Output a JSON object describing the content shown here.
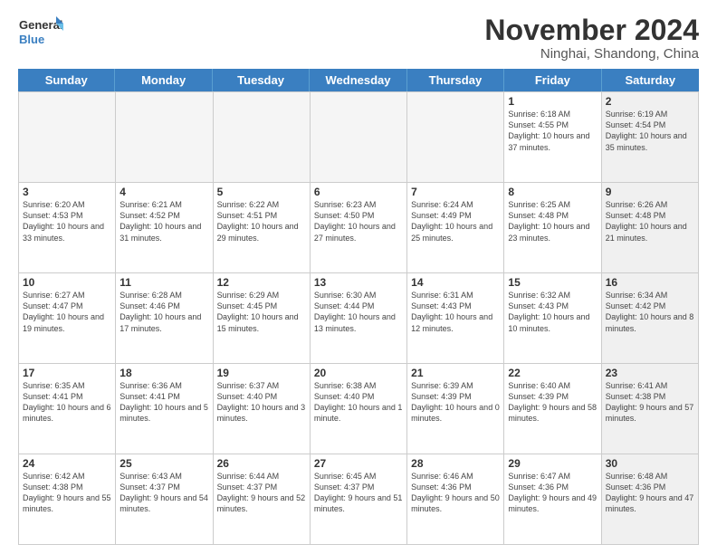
{
  "header": {
    "logo_line1": "General",
    "logo_line2": "Blue",
    "month_title": "November 2024",
    "location": "Ninghai, Shandong, China"
  },
  "days_of_week": [
    "Sunday",
    "Monday",
    "Tuesday",
    "Wednesday",
    "Thursday",
    "Friday",
    "Saturday"
  ],
  "weeks": [
    [
      {
        "num": "",
        "info": "",
        "empty": true
      },
      {
        "num": "",
        "info": "",
        "empty": true
      },
      {
        "num": "",
        "info": "",
        "empty": true
      },
      {
        "num": "",
        "info": "",
        "empty": true
      },
      {
        "num": "",
        "info": "",
        "empty": true
      },
      {
        "num": "1",
        "info": "Sunrise: 6:18 AM\nSunset: 4:55 PM\nDaylight: 10 hours\nand 37 minutes.",
        "shaded": false
      },
      {
        "num": "2",
        "info": "Sunrise: 6:19 AM\nSunset: 4:54 PM\nDaylight: 10 hours\nand 35 minutes.",
        "shaded": true
      }
    ],
    [
      {
        "num": "3",
        "info": "Sunrise: 6:20 AM\nSunset: 4:53 PM\nDaylight: 10 hours\nand 33 minutes.",
        "shaded": false
      },
      {
        "num": "4",
        "info": "Sunrise: 6:21 AM\nSunset: 4:52 PM\nDaylight: 10 hours\nand 31 minutes.",
        "shaded": false
      },
      {
        "num": "5",
        "info": "Sunrise: 6:22 AM\nSunset: 4:51 PM\nDaylight: 10 hours\nand 29 minutes.",
        "shaded": false
      },
      {
        "num": "6",
        "info": "Sunrise: 6:23 AM\nSunset: 4:50 PM\nDaylight: 10 hours\nand 27 minutes.",
        "shaded": false
      },
      {
        "num": "7",
        "info": "Sunrise: 6:24 AM\nSunset: 4:49 PM\nDaylight: 10 hours\nand 25 minutes.",
        "shaded": false
      },
      {
        "num": "8",
        "info": "Sunrise: 6:25 AM\nSunset: 4:48 PM\nDaylight: 10 hours\nand 23 minutes.",
        "shaded": false
      },
      {
        "num": "9",
        "info": "Sunrise: 6:26 AM\nSunset: 4:48 PM\nDaylight: 10 hours\nand 21 minutes.",
        "shaded": true
      }
    ],
    [
      {
        "num": "10",
        "info": "Sunrise: 6:27 AM\nSunset: 4:47 PM\nDaylight: 10 hours\nand 19 minutes.",
        "shaded": false
      },
      {
        "num": "11",
        "info": "Sunrise: 6:28 AM\nSunset: 4:46 PM\nDaylight: 10 hours\nand 17 minutes.",
        "shaded": false
      },
      {
        "num": "12",
        "info": "Sunrise: 6:29 AM\nSunset: 4:45 PM\nDaylight: 10 hours\nand 15 minutes.",
        "shaded": false
      },
      {
        "num": "13",
        "info": "Sunrise: 6:30 AM\nSunset: 4:44 PM\nDaylight: 10 hours\nand 13 minutes.",
        "shaded": false
      },
      {
        "num": "14",
        "info": "Sunrise: 6:31 AM\nSunset: 4:43 PM\nDaylight: 10 hours\nand 12 minutes.",
        "shaded": false
      },
      {
        "num": "15",
        "info": "Sunrise: 6:32 AM\nSunset: 4:43 PM\nDaylight: 10 hours\nand 10 minutes.",
        "shaded": false
      },
      {
        "num": "16",
        "info": "Sunrise: 6:34 AM\nSunset: 4:42 PM\nDaylight: 10 hours\nand 8 minutes.",
        "shaded": true
      }
    ],
    [
      {
        "num": "17",
        "info": "Sunrise: 6:35 AM\nSunset: 4:41 PM\nDaylight: 10 hours\nand 6 minutes.",
        "shaded": false
      },
      {
        "num": "18",
        "info": "Sunrise: 6:36 AM\nSunset: 4:41 PM\nDaylight: 10 hours\nand 5 minutes.",
        "shaded": false
      },
      {
        "num": "19",
        "info": "Sunrise: 6:37 AM\nSunset: 4:40 PM\nDaylight: 10 hours\nand 3 minutes.",
        "shaded": false
      },
      {
        "num": "20",
        "info": "Sunrise: 6:38 AM\nSunset: 4:40 PM\nDaylight: 10 hours\nand 1 minute.",
        "shaded": false
      },
      {
        "num": "21",
        "info": "Sunrise: 6:39 AM\nSunset: 4:39 PM\nDaylight: 10 hours\nand 0 minutes.",
        "shaded": false
      },
      {
        "num": "22",
        "info": "Sunrise: 6:40 AM\nSunset: 4:39 PM\nDaylight: 9 hours\nand 58 minutes.",
        "shaded": false
      },
      {
        "num": "23",
        "info": "Sunrise: 6:41 AM\nSunset: 4:38 PM\nDaylight: 9 hours\nand 57 minutes.",
        "shaded": true
      }
    ],
    [
      {
        "num": "24",
        "info": "Sunrise: 6:42 AM\nSunset: 4:38 PM\nDaylight: 9 hours\nand 55 minutes.",
        "shaded": false
      },
      {
        "num": "25",
        "info": "Sunrise: 6:43 AM\nSunset: 4:37 PM\nDaylight: 9 hours\nand 54 minutes.",
        "shaded": false
      },
      {
        "num": "26",
        "info": "Sunrise: 6:44 AM\nSunset: 4:37 PM\nDaylight: 9 hours\nand 52 minutes.",
        "shaded": false
      },
      {
        "num": "27",
        "info": "Sunrise: 6:45 AM\nSunset: 4:37 PM\nDaylight: 9 hours\nand 51 minutes.",
        "shaded": false
      },
      {
        "num": "28",
        "info": "Sunrise: 6:46 AM\nSunset: 4:36 PM\nDaylight: 9 hours\nand 50 minutes.",
        "shaded": false
      },
      {
        "num": "29",
        "info": "Sunrise: 6:47 AM\nSunset: 4:36 PM\nDaylight: 9 hours\nand 49 minutes.",
        "shaded": false
      },
      {
        "num": "30",
        "info": "Sunrise: 6:48 AM\nSunset: 4:36 PM\nDaylight: 9 hours\nand 47 minutes.",
        "shaded": true
      }
    ]
  ]
}
